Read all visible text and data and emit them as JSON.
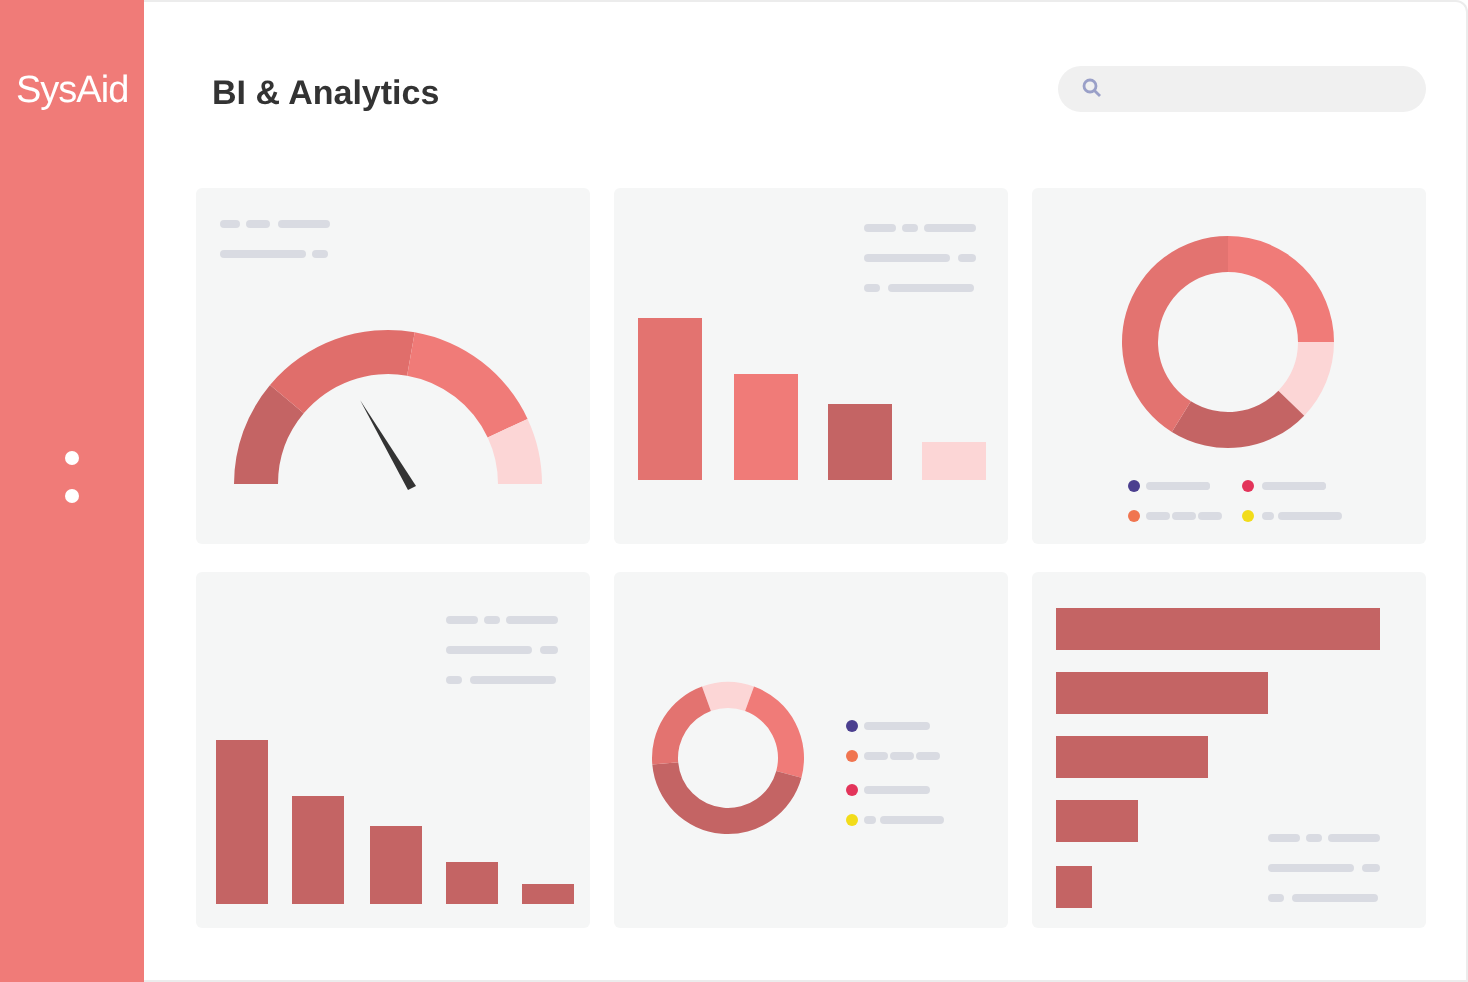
{
  "logo": "SysAid",
  "page_title": "BI & Analytics",
  "cards": [
    {
      "kind": "gauge"
    },
    {
      "kind": "bar"
    },
    {
      "kind": "donut",
      "legend": [
        {
          "color": "#4b3f8f"
        },
        {
          "color": "#e3345a"
        },
        {
          "color": "#f07550"
        },
        {
          "color": "#f2dc1a"
        }
      ]
    },
    {
      "kind": "bar2"
    },
    {
      "kind": "donut2",
      "legend": [
        {
          "color": "#4b3f8f"
        },
        {
          "color": "#f07550"
        },
        {
          "color": "#e3345a"
        },
        {
          "color": "#f2dc1a"
        }
      ]
    },
    {
      "kind": "hbar"
    }
  ]
}
